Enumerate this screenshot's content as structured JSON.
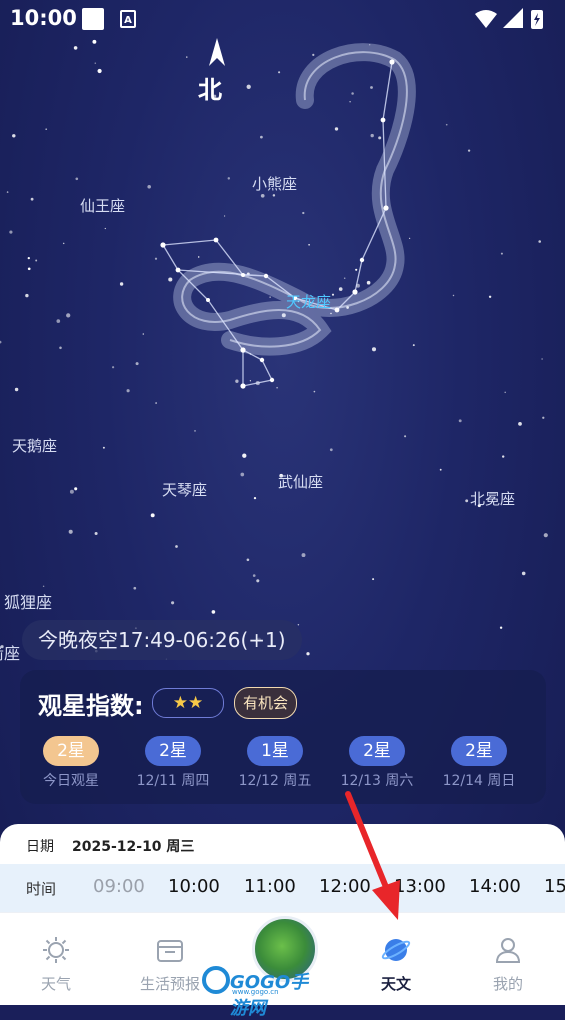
{
  "status_bar": {
    "time": "10:00"
  },
  "compass": {
    "label": "北"
  },
  "constellations": [
    {
      "name": "小熊座"
    },
    {
      "name": "仙王座"
    },
    {
      "name": "天龙座"
    },
    {
      "name": "天鹅座"
    },
    {
      "name": "天琴座"
    },
    {
      "name": "武仙座"
    },
    {
      "name": "北冕座"
    },
    {
      "name": "狐狸座"
    },
    {
      "name": "箭座"
    }
  ],
  "tonight": {
    "text": "今晚夜空17:49-06:26(+1)"
  },
  "stargazing": {
    "title": "观星指数:",
    "stars": "★★",
    "chance": "有机会",
    "days": [
      {
        "rating": "2星",
        "label": "今日观星"
      },
      {
        "rating": "2星",
        "label": "12/11 周四"
      },
      {
        "rating": "1星",
        "label": "12/12 周五"
      },
      {
        "rating": "2星",
        "label": "12/13 周六"
      },
      {
        "rating": "2星",
        "label": "12/14 周日"
      }
    ]
  },
  "detail": {
    "date_key": "日期",
    "date_value": "2025-12-10 周三",
    "time_key": "时间",
    "times": [
      "09:00",
      "10:00",
      "11:00",
      "12:00",
      "13:00",
      "14:00",
      "15"
    ]
  },
  "tabs": [
    {
      "label": "天气",
      "icon": "sun-icon"
    },
    {
      "label": "生活预报",
      "icon": "folder-icon"
    },
    {
      "label": "天文",
      "icon": "planet-icon"
    },
    {
      "label": "我的",
      "icon": "user-icon"
    }
  ],
  "watermark": {
    "brand": "GOGO手游网",
    "url": "www.gogo.cn"
  },
  "colors": {
    "accent": "#4a6bd6",
    "active_badge": "#f3c690",
    "highlight": "#4fc8ff",
    "arrow": "#e8262a"
  }
}
